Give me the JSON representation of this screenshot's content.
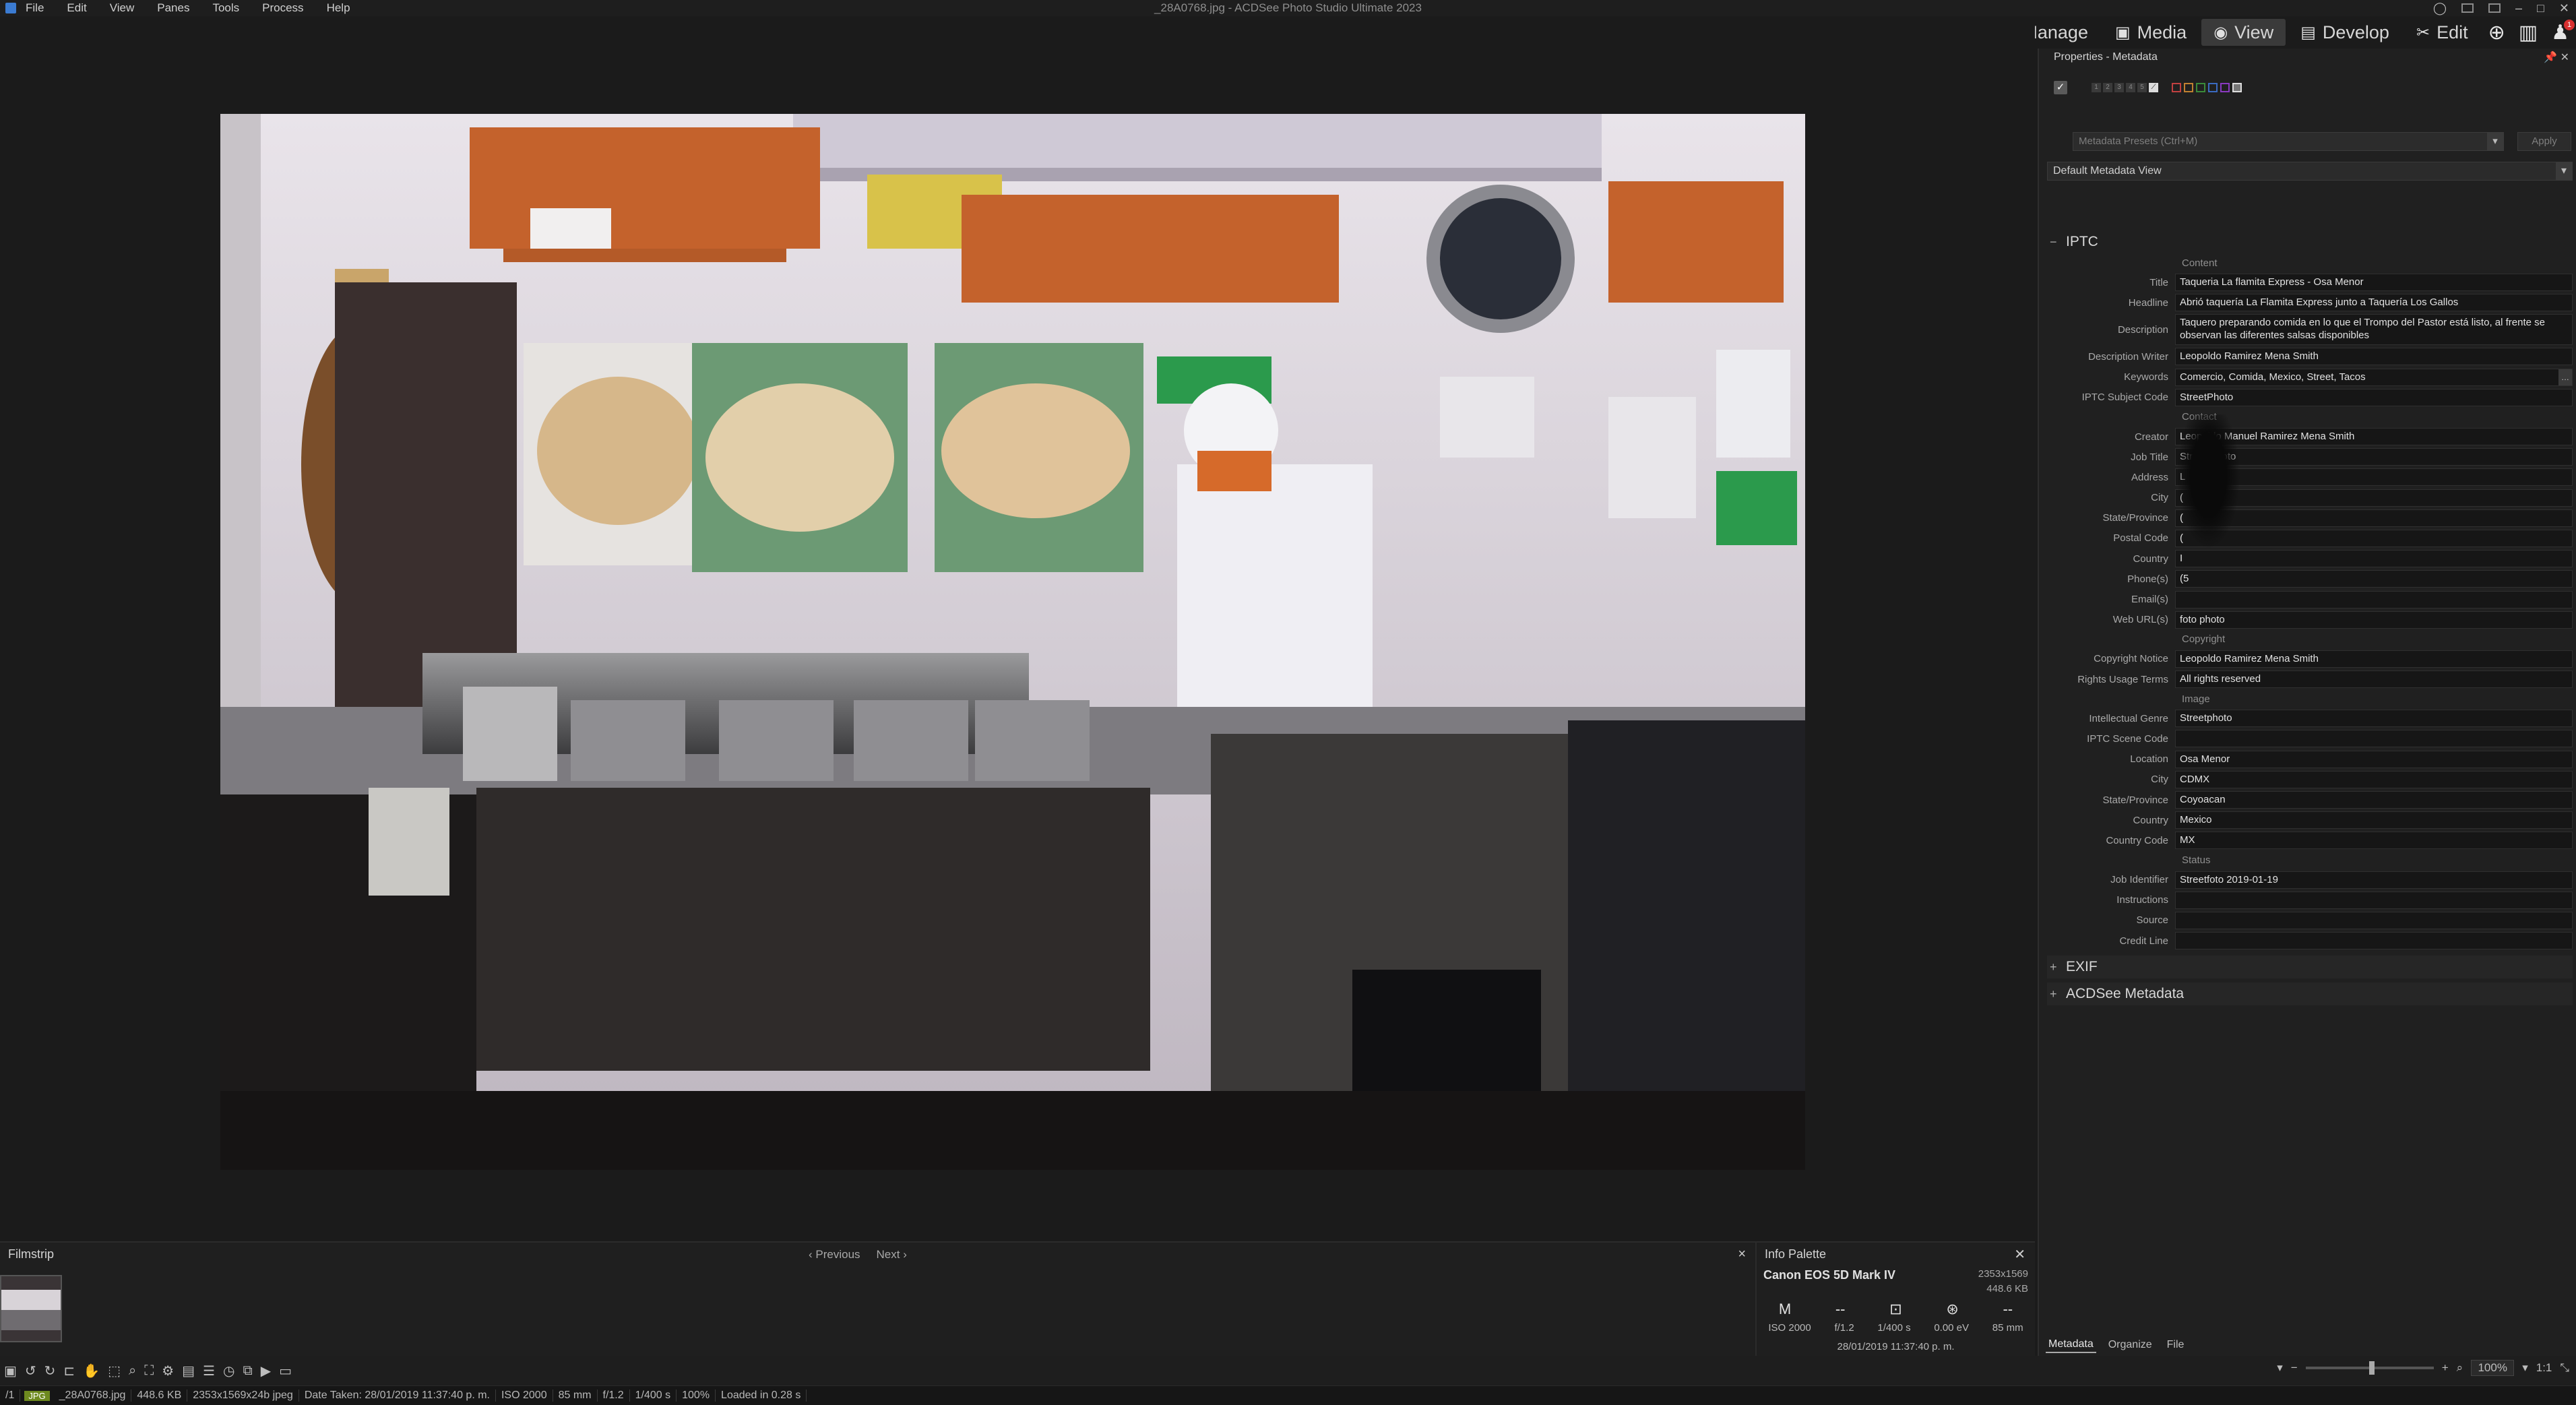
{
  "window": {
    "title": "_28A0768.jpg - ACDSee Photo Studio Ultimate 2023",
    "menu": [
      "File",
      "Edit",
      "View",
      "Panes",
      "Tools",
      "Process",
      "Help"
    ]
  },
  "modes": [
    {
      "label": "Manage",
      "icon": "grid-icon",
      "active": false
    },
    {
      "label": "Media",
      "icon": "media-icon",
      "active": false
    },
    {
      "label": "View",
      "icon": "eye-icon",
      "active": true
    },
    {
      "label": "Develop",
      "icon": "develop-icon",
      "active": false
    },
    {
      "label": "Edit",
      "icon": "edit-icon",
      "active": false
    }
  ],
  "filmstrip": {
    "title": "Filmstrip",
    "previous": "Previous",
    "next": "Next",
    "close": "×"
  },
  "info_palette": {
    "title": "Info Palette",
    "camera": "Canon EOS 5D Mark IV",
    "dimensions": "2353x1569",
    "filesize": "448.6 KB",
    "mode": "M",
    "iso": "ISO 2000",
    "aperture": "f/1.2",
    "shutter": "1/400 s",
    "ev": "0.00 eV",
    "focal": "85 mm",
    "date": "28/01/2019 11:37:40 p. m.",
    "dash1": "--",
    "dash2": "--"
  },
  "panel": {
    "title": "Properties - Metadata",
    "presets_placeholder": "Metadata Presets (Ctrl+M)",
    "apply": "Apply",
    "view_select": "Default Metadata View",
    "iptc_title": "IPTC",
    "exif_title": "EXIF",
    "acdsee_title": "ACDSee Metadata",
    "tabs": [
      "Metadata",
      "Organize",
      "File"
    ],
    "groups": {
      "content": "Content",
      "contact": "Contact",
      "copyright": "Copyright",
      "image": "Image",
      "status": "Status"
    },
    "fields": {
      "title": {
        "label": "Title",
        "value": "Taqueria La flamita Express - Osa Menor"
      },
      "headline": {
        "label": "Headline",
        "value": "Abrió taquería La Flamita Express junto a Taquería Los Gallos"
      },
      "description": {
        "label": "Description",
        "value": "Taquero preparando comida en lo que el Trompo del Pastor está listo, al frente se observan las diferentes salsas disponibles"
      },
      "description_writer": {
        "label": "Description Writer",
        "value": "Leopoldo Ramirez Mena Smith"
      },
      "keywords": {
        "label": "Keywords",
        "value": "Comercio, Comida, Mexico, Street, Tacos"
      },
      "subject_code": {
        "label": "IPTC Subject Code",
        "value": "StreetPhoto"
      },
      "creator": {
        "label": "Creator",
        "value": "Leopoldo Manuel Ramirez Mena Smith"
      },
      "job_title": {
        "label": "Job Title",
        "value": "Street Photo"
      },
      "address": {
        "label": "Address",
        "value": "L"
      },
      "city": {
        "label": "City",
        "value": "("
      },
      "state": {
        "label": "State/Province",
        "value": "("
      },
      "postal": {
        "label": "Postal Code",
        "value": "("
      },
      "country": {
        "label": "Country",
        "value": "I"
      },
      "phones": {
        "label": "Phone(s)",
        "value": "(5"
      },
      "emails": {
        "label": "Email(s)",
        "value": ""
      },
      "web": {
        "label": "Web URL(s)",
        "value": "foto photo"
      },
      "copyright_notice": {
        "label": "Copyright Notice",
        "value": "Leopoldo Ramirez Mena Smith"
      },
      "rights": {
        "label": "Rights Usage Terms",
        "value": "All rights reserved"
      },
      "genre": {
        "label": "Intellectual Genre",
        "value": "Streetphoto"
      },
      "scene": {
        "label": "IPTC Scene Code",
        "value": ""
      },
      "location": {
        "label": "Location",
        "value": "Osa Menor"
      },
      "img_city": {
        "label": "City",
        "value": "CDMX"
      },
      "img_state": {
        "label": "State/Province",
        "value": "Coyoacan"
      },
      "img_country": {
        "label": "Country",
        "value": "Mexico"
      },
      "country_code": {
        "label": "Country Code",
        "value": "MX"
      },
      "job_id": {
        "label": "Job Identifier",
        "value": "Streetfoto 2019-01-19"
      },
      "instructions": {
        "label": "Instructions",
        "value": ""
      },
      "source": {
        "label": "Source",
        "value": ""
      },
      "credit": {
        "label": "Credit Line",
        "value": ""
      }
    },
    "color_labels": [
      "#c04040",
      "#c08030",
      "#3a8a3a",
      "#3a6ac0",
      "#8a3ac0"
    ]
  },
  "toolbar": {
    "zoom": "100%",
    "ratio": "1:1"
  },
  "status": {
    "index": "/1",
    "type": "JPG",
    "filename": "_28A0768.jpg",
    "size": "448.6 KB",
    "dims": "2353x1569x24b jpeg",
    "date": "Date Taken: 28/01/2019 11:37:40 p. m.",
    "iso": "ISO 2000",
    "focal": "85 mm",
    "aperture": "f/1.2",
    "shutter": "1/400 s",
    "zoom": "100%",
    "loaded": "Loaded in 0.28 s"
  }
}
